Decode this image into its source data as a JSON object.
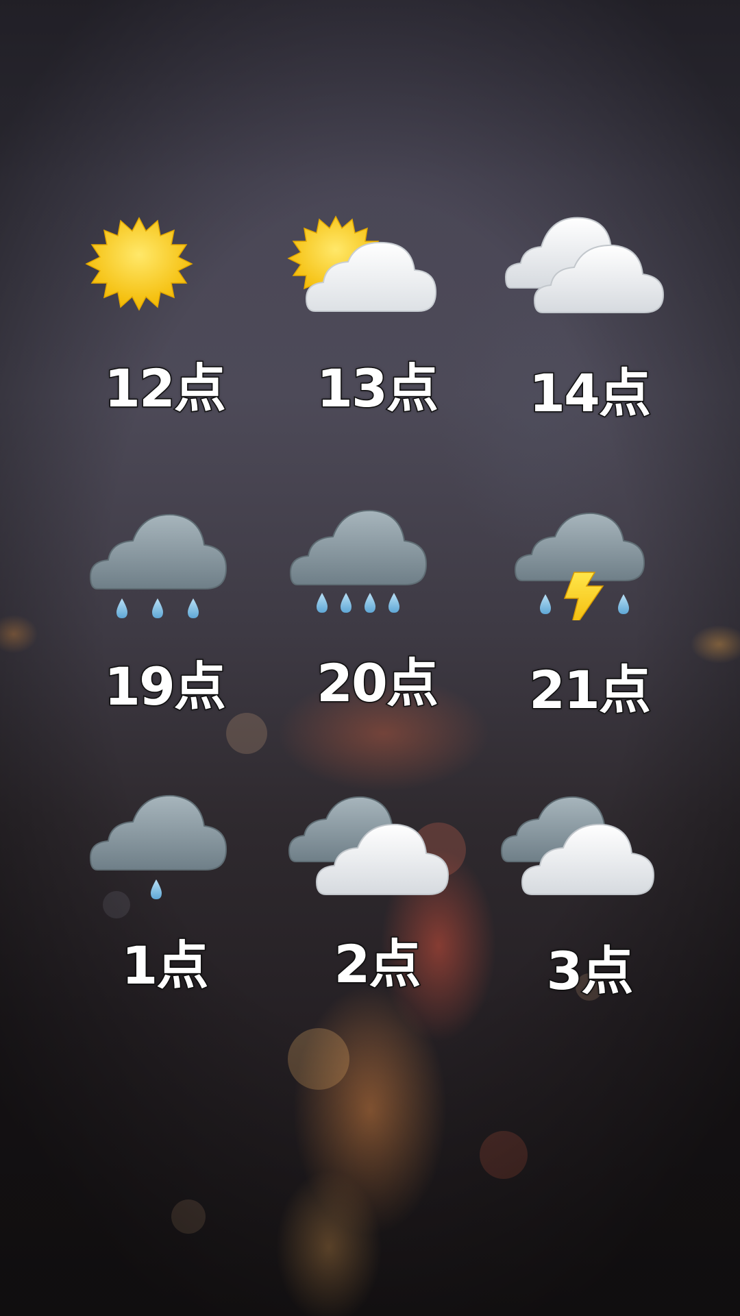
{
  "hourly_forecast": [
    {
      "time": "12点",
      "icon": "sun-icon"
    },
    {
      "time": "13点",
      "icon": "partly-sunny-icon"
    },
    {
      "time": "14点",
      "icon": "cloudy-icon"
    },
    {
      "time": "19点",
      "icon": "rain-icon"
    },
    {
      "time": "20点",
      "icon": "heavy-rain-icon"
    },
    {
      "time": "21点",
      "icon": "thunderstorm-icon"
    },
    {
      "time": "1点",
      "icon": "light-rain-icon"
    },
    {
      "time": "2点",
      "icon": "overcast-icon"
    },
    {
      "time": "3点",
      "icon": "overcast-icon"
    }
  ],
  "colors": {
    "sun": "#f6c400",
    "white_cloud": "#eef0f2",
    "grey_cloud": "#7f8f98",
    "raindrop": "#7fbbe0",
    "lightning": "#ffd21f"
  }
}
